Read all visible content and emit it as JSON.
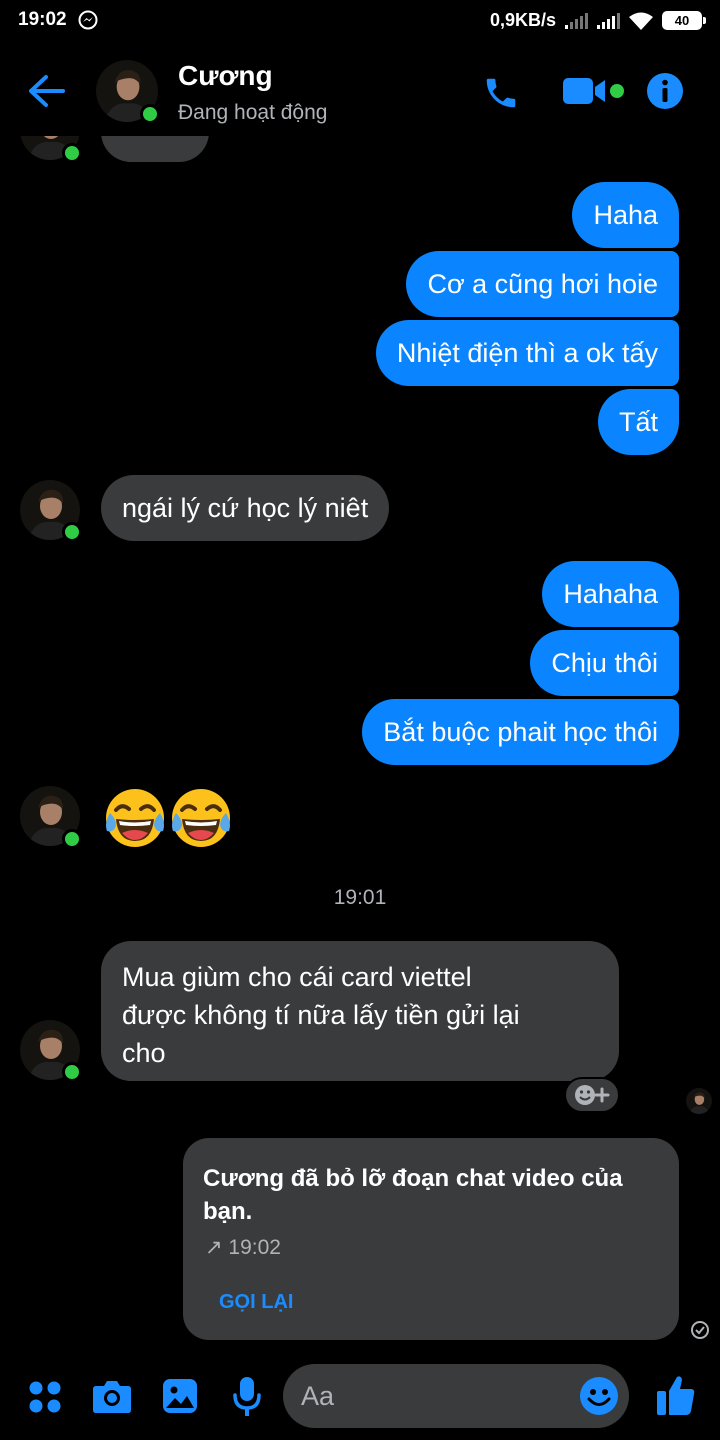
{
  "status_bar": {
    "time": "19:02",
    "net_speed": "0,9KB/s",
    "battery": "40"
  },
  "header": {
    "name": "Cương",
    "status": "Đang hoạt động"
  },
  "messages": [
    {
      "side": "sent",
      "text": "Haha"
    },
    {
      "side": "sent",
      "text": "Cơ a cũng hơi hoie"
    },
    {
      "side": "sent",
      "text": "Nhiệt điện thì a ok tấy"
    },
    {
      "side": "sent",
      "text": "Tất"
    },
    {
      "side": "received",
      "text": "ngái lý cứ học lý niêt"
    },
    {
      "side": "sent",
      "text": "Hahaha"
    },
    {
      "side": "sent",
      "text": "Chịu thôi"
    },
    {
      "side": "sent",
      "text": "Bắt buộc phait học thôi"
    },
    {
      "side": "received",
      "text": "😂😂"
    },
    {
      "side": "received",
      "lines": [
        "Mua giùm cho  cái card viettel",
        "được không tí nữa  lấy tiền gửi lại",
        "cho"
      ]
    }
  ],
  "timestamp": "19:01",
  "call_card": {
    "title": "Cương đã bỏ lỡ đoạn chat video của bạn.",
    "time": "↗ 19:02",
    "action": "GỌI LẠI"
  },
  "composer": {
    "placeholder": "Aa"
  },
  "colors": {
    "sent_bubble": "#0a84ff",
    "received_bubble": "#3a3b3c",
    "accent": "#1a8cff",
    "online": "#31cc46"
  },
  "icons": [
    "back-arrow-icon",
    "phone-icon",
    "video-camera-icon",
    "info-icon",
    "apps-grid-icon",
    "camera-icon",
    "gallery-icon",
    "microphone-icon",
    "smiley-icon",
    "thumbs-up-icon"
  ]
}
